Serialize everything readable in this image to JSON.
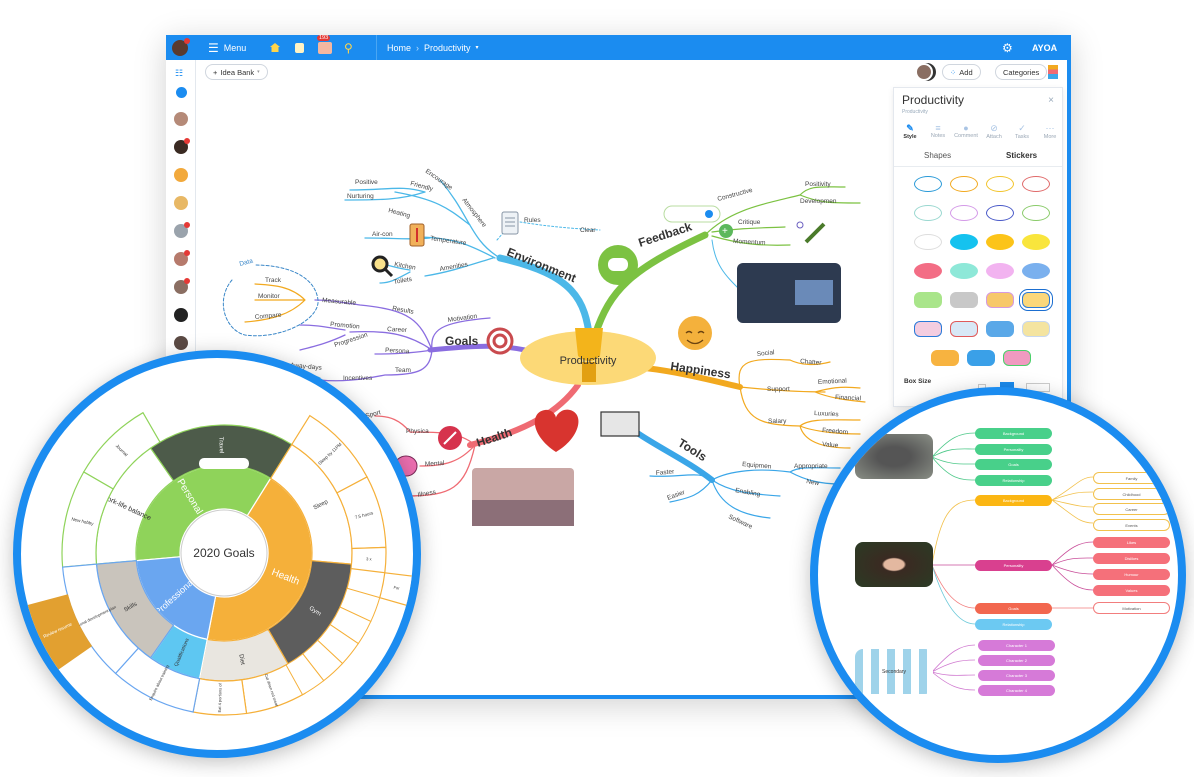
{
  "topbar": {
    "menu": "Menu",
    "notification_count": "193",
    "breadcrumb_home": "Home",
    "breadcrumb_current": "Productivity",
    "brand": "AYOA"
  },
  "toolbar": {
    "idea_bank": "Idea Bank",
    "add": "Add",
    "categories": "Categories"
  },
  "panel": {
    "title": "Productivity",
    "subtitle": "Productivity",
    "tabs": [
      "Style",
      "Notes",
      "Comment",
      "Attach",
      "Tasks",
      "More"
    ],
    "shapes_tab": "Shapes",
    "stickers_tab": "Stickers",
    "box_size": "Box Size"
  },
  "mindmap": {
    "central": "Productivity",
    "environment": {
      "title": "Environment",
      "nodes": [
        "Atmosphere",
        "Friendly",
        "Encourage",
        "Positive",
        "Nurturing",
        "Temperature",
        "Heating",
        "Air-con",
        "Amenities",
        "Kitchen",
        "Toilets",
        "Rules",
        "Clear"
      ]
    },
    "goals": {
      "title": "Goals",
      "nodes": [
        "Motivation",
        "Results",
        "Measurable",
        "Data",
        "Track",
        "Monitor",
        "Compare",
        "Career",
        "Promotion",
        "Progression",
        "Persona",
        "Team",
        "Incentives",
        "Away-days"
      ]
    },
    "feedback": {
      "title": "Feedback",
      "nodes": [
        "Constructive",
        "Positivity",
        "Developmen",
        "Critique",
        "Momentum"
      ]
    },
    "happiness": {
      "title": "Happiness",
      "nodes": [
        "Social",
        "Chatter",
        "Support",
        "Emotional",
        "Financial",
        "Salary",
        "Luxuries",
        "Freedom",
        "Value"
      ]
    },
    "tools": {
      "title": "Tools",
      "nodes": [
        "Equipmen",
        "Appropriate",
        "New",
        "Faster",
        "Easier",
        "Enabling",
        "Software"
      ]
    },
    "health": {
      "title": "Health",
      "nodes": [
        "Sport",
        "Physica",
        "Mental",
        "Illness"
      ]
    }
  },
  "goals_wheel": {
    "center": "2020 Goals",
    "segments": [
      "Personal",
      "Health",
      "Professional",
      "Travel",
      "Work-life balance",
      "Sleep",
      "Gym",
      "Diet",
      "Qualifications",
      "Skills",
      "Journal",
      "New hobby",
      "Sleep by 11PM",
      "7.5 hours",
      "3 x",
      "For",
      "Cut down red meat",
      "Eat 4 portions of",
      "Enquire about training",
      "Personal development plan",
      "Review resume"
    ]
  },
  "character_map": {
    "group1": [
      "Background",
      "Personality",
      "Goals",
      "Relationship"
    ],
    "background": "Background",
    "background_children": [
      "Family",
      "Childhood",
      "Career",
      "Events"
    ],
    "personality": "Personality",
    "personality_children": [
      "Likes",
      "Dislikes",
      "Humour",
      "Values"
    ],
    "goals": "Goals",
    "goals_child": "Motivation",
    "relationship": "Relationship",
    "secondary": "Secondary",
    "characters": [
      "Character 1",
      "Character 2",
      "Character 3",
      "Character 4"
    ]
  },
  "colors": {
    "brand": "#1b8cf0",
    "environment": "#4cb8e8",
    "goals": "#8a6de0",
    "feedback": "#7cc242",
    "happiness": "#f2a91f",
    "tools": "#3aa6e8",
    "health": "#ef6b73"
  }
}
